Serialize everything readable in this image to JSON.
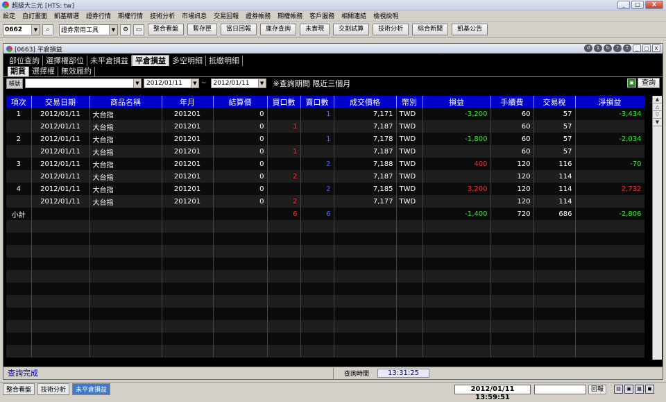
{
  "app": {
    "title": "超級大三元  [HTS: tw]"
  },
  "menu": [
    "設定",
    "自訂畫面",
    "凱基精選",
    "證券行情",
    "期權行情",
    "技術分析",
    "市場訊息",
    "交易回報",
    "證券帳務",
    "期權帳務",
    "客戶服務",
    "相關連結",
    "檢視說明"
  ],
  "toolbar": {
    "stock_code": "0662",
    "tool_select": "證券常用工具",
    "buttons": [
      "整合看盤",
      "暫存匣",
      "當日回報",
      "庫存查詢",
      "未實現",
      "交割試算",
      "技術分析",
      "綜合新聞",
      "凱基公告"
    ]
  },
  "window": {
    "title": "[0663] 平倉損益",
    "ctrl_labels": [
      "↺",
      "1",
      "↻",
      "?",
      "T",
      "_",
      "□",
      "X"
    ]
  },
  "tabs_main": [
    "部位查詢",
    "選擇權部位",
    "未平倉損益",
    "平倉損益",
    "多空明細",
    "抵繳明細"
  ],
  "tabs_sub": [
    "期貨",
    "選擇權",
    "無效履約"
  ],
  "filter": {
    "account_label": "帳號",
    "account_value": "",
    "date_from": "2012/01/11",
    "date_to": "2012/01/11",
    "separator": "~",
    "note": "※查詢期間 限近三個月",
    "query_button": "查詢"
  },
  "table": {
    "columns": [
      "項次",
      "交易日期",
      "商品名稱",
      "年月",
      "結算價",
      "買口數",
      "賣口數",
      "成交價格",
      "幣別",
      "損益",
      "手續費",
      "交易稅",
      "淨損益"
    ],
    "rows": [
      {
        "no": "1",
        "date": "2012/01/11",
        "product": "大台指",
        "ym": "201201",
        "settle": "0",
        "buy": "",
        "sell": "1",
        "price": "7,171",
        "cur": "TWD",
        "pl": "-3,200",
        "fee": "60",
        "tax": "57",
        "net": "-3,434",
        "pl_color": "green",
        "net_color": "green"
      },
      {
        "no": "",
        "date": "2012/01/11",
        "product": "大台指",
        "ym": "201201",
        "settle": "0",
        "buy": "1",
        "sell": "",
        "price": "7,187",
        "cur": "TWD",
        "pl": "",
        "fee": "60",
        "tax": "57",
        "net": "",
        "pl_color": "",
        "net_color": ""
      },
      {
        "no": "2",
        "date": "2012/01/11",
        "product": "大台指",
        "ym": "201201",
        "settle": "0",
        "buy": "",
        "sell": "1",
        "price": "7,178",
        "cur": "TWD",
        "pl": "-1,800",
        "fee": "60",
        "tax": "57",
        "net": "-2,034",
        "pl_color": "green",
        "net_color": "green"
      },
      {
        "no": "",
        "date": "2012/01/11",
        "product": "大台指",
        "ym": "201201",
        "settle": "0",
        "buy": "1",
        "sell": "",
        "price": "7,187",
        "cur": "TWD",
        "pl": "",
        "fee": "60",
        "tax": "57",
        "net": "",
        "pl_color": "",
        "net_color": ""
      },
      {
        "no": "3",
        "date": "2012/01/11",
        "product": "大台指",
        "ym": "201201",
        "settle": "0",
        "buy": "",
        "sell": "2",
        "price": "7,188",
        "cur": "TWD",
        "pl": "400",
        "fee": "120",
        "tax": "116",
        "net": "-70",
        "pl_color": "red",
        "net_color": "green"
      },
      {
        "no": "",
        "date": "2012/01/11",
        "product": "大台指",
        "ym": "201201",
        "settle": "0",
        "buy": "2",
        "sell": "",
        "price": "7,187",
        "cur": "TWD",
        "pl": "",
        "fee": "120",
        "tax": "114",
        "net": "",
        "pl_color": "",
        "net_color": ""
      },
      {
        "no": "4",
        "date": "2012/01/11",
        "product": "大台指",
        "ym": "201201",
        "settle": "0",
        "buy": "",
        "sell": "2",
        "price": "7,185",
        "cur": "TWD",
        "pl": "3,200",
        "fee": "120",
        "tax": "114",
        "net": "2,732",
        "pl_color": "red",
        "net_color": "red"
      },
      {
        "no": "",
        "date": "2012/01/11",
        "product": "大台指",
        "ym": "201201",
        "settle": "0",
        "buy": "2",
        "sell": "",
        "price": "7,177",
        "cur": "TWD",
        "pl": "",
        "fee": "120",
        "tax": "114",
        "net": "",
        "pl_color": "",
        "net_color": ""
      }
    ],
    "subtotal": {
      "label": "小計",
      "buy": "6",
      "sell": "6",
      "pl": "-1,400",
      "fee": "720",
      "tax": "686",
      "net": "-2,806"
    }
  },
  "status": {
    "message": "查詢完成",
    "time_label": "查詢時間",
    "time_value": "13:31:25"
  },
  "taskbar": {
    "items": [
      "整合看盤",
      "技術分析",
      "未平倉損益"
    ],
    "active": 2,
    "clock": "2012/01/11 13:59:51",
    "report_button": "回報"
  },
  "colors": {
    "header_blue": "#0000cc",
    "profit_red": "#ff2a2a",
    "loss_green": "#33ee33",
    "qty_blue": "#5060ff"
  }
}
